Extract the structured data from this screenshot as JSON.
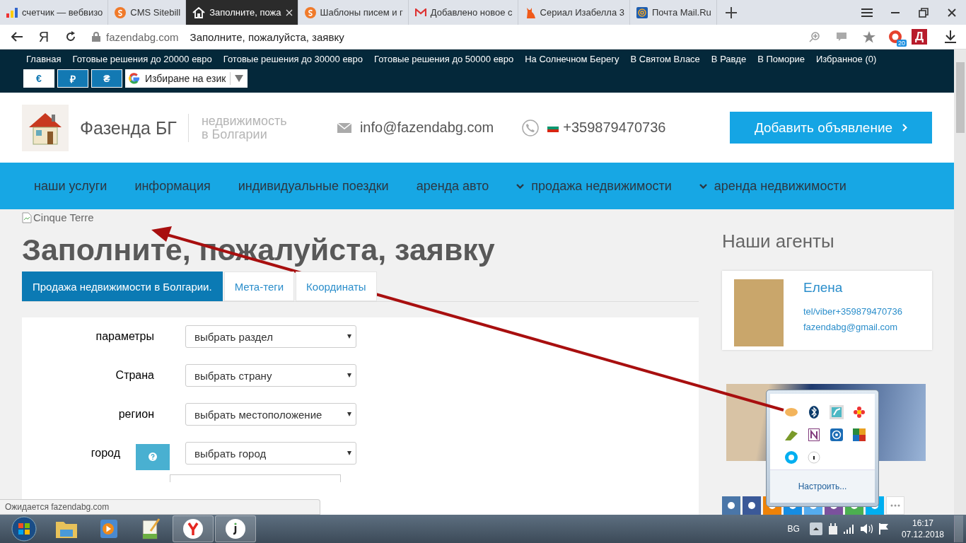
{
  "browser": {
    "tabs": [
      {
        "title": "счетчик — вебвизо",
        "selected": false,
        "kind": "bars"
      },
      {
        "title": "CMS Sitebill",
        "selected": false,
        "kind": "circle"
      },
      {
        "title": "Заполните, пожа",
        "selected": true,
        "kind": "house"
      },
      {
        "title": "Шаблоны писем и г",
        "selected": false,
        "kind": "circle"
      },
      {
        "title": "Добавлено новое с",
        "selected": false,
        "kind": "envelope"
      },
      {
        "title": "Сериал Изабелла 3",
        "selected": false,
        "kind": "cat"
      },
      {
        "title": "Почта Mail.Ru",
        "selected": false,
        "kind": "at"
      }
    ],
    "yandex_key": "Я",
    "domain": "fazendabg.com",
    "page_title": "Заполните, пожалуйста, заявку",
    "extension_badge": "20",
    "extension_letter": "Д"
  },
  "site": {
    "top_links": [
      "Главная",
      "Готовые решения до 20000 евро",
      "Готовые решения до 30000 евро",
      "Готовые решения до 50000 евро",
      "На Солнечном Берегу",
      "В Святом Власе",
      "В Равде",
      "В Поморие",
      "Избранное (0)"
    ],
    "currencies": [
      {
        "symbol": "€",
        "selected": true
      },
      {
        "symbol": "₽",
        "selected": false
      },
      {
        "symbol": "₴",
        "selected": false
      }
    ],
    "language_select": "Избиране на език",
    "header": {
      "name": "Фазенда БГ",
      "tagline": [
        "недвижимость",
        "в Болгарии"
      ],
      "email": "info@fazendabg.com",
      "phone": "+359879470736",
      "add_button": "Добавить объявление"
    },
    "menu": [
      {
        "label": "наши услуги",
        "dropdown": false
      },
      {
        "label": "информация",
        "dropdown": false
      },
      {
        "label": "индивидуальные поездки",
        "dropdown": false
      },
      {
        "label": "аренда авто",
        "dropdown": false
      },
      {
        "label": "продажа недвижимости",
        "dropdown": true
      },
      {
        "label": "аренда недвижимости",
        "dropdown": true
      }
    ],
    "image_alt": "Cinque Terre",
    "heading": "Заполните, пожалуйста, заявку",
    "form_tabs": [
      {
        "label": "Продажа недвижимости в Болгарии.",
        "selected": true
      },
      {
        "label": "Мета-теги",
        "selected": false
      },
      {
        "label": "Координаты",
        "selected": false
      }
    ],
    "form_rows": [
      {
        "label": "параметры",
        "value": "выбрать раздел",
        "help": false
      },
      {
        "label": "Страна",
        "value": "выбрать страну",
        "help": false
      },
      {
        "label": "регион",
        "value": "выбрать местоположение",
        "help": false
      },
      {
        "label": "город",
        "value": "выбрать город",
        "help": true
      }
    ],
    "agents": {
      "title": "Наши агенты",
      "name": "Елена",
      "phone": "tel/viber+359879470736",
      "email": "fazendabg@gmail.com"
    }
  },
  "status_text": "Ожидается fazendabg.com",
  "tray_popup": {
    "link": "Настроить..."
  },
  "taskbar": {
    "language": "BG",
    "time": "16:17",
    "date": "07.12.2018"
  }
}
